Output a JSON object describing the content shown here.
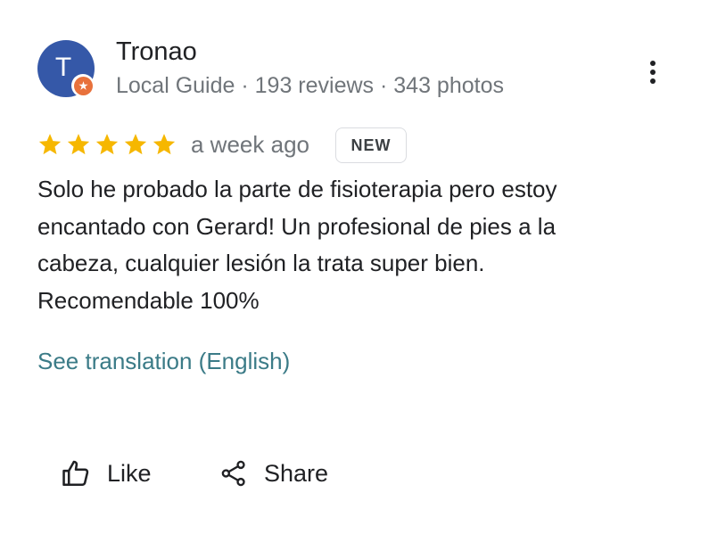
{
  "author": {
    "initial": "T",
    "name": "Tronao",
    "meta": "Local Guide · 193 reviews · 343 photos",
    "avatar_color": "#3558a8",
    "badge_color": "#e8713c",
    "avatar_icon": "avatar-letter",
    "badge_icon": "local-guide-star-icon"
  },
  "more_menu": {
    "icon": "more-vert-icon"
  },
  "rating": {
    "stars": 5,
    "max_stars": 5,
    "star_color": "#f6b700",
    "date": "a week ago",
    "badge": "NEW"
  },
  "body": {
    "lines": [
      "Solo he probado la parte de fisioterapia pero estoy",
      "encantado con Gerard! Un profesional de pies a la",
      "cabeza, cualquier lesión la trata super bien.",
      "Recomendable 100%"
    ]
  },
  "translation": {
    "label": "See translation (English)",
    "color": "#3b7b87"
  },
  "actions": {
    "like_label": "Like",
    "like_icon": "thumb-up-icon",
    "share_label": "Share",
    "share_icon": "share-icon"
  }
}
